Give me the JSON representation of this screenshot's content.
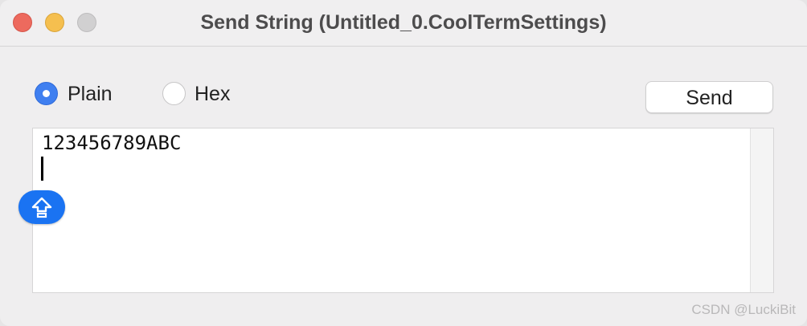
{
  "window": {
    "title": "Send String (Untitled_0.CoolTermSettings)"
  },
  "format": {
    "options": [
      {
        "label": "Plain",
        "selected": true
      },
      {
        "label": "Hex",
        "selected": false
      }
    ]
  },
  "actions": {
    "send_label": "Send"
  },
  "editor": {
    "text": "123456789ABC"
  },
  "indicators": {
    "caps_lock_icon": "caps-lock-icon"
  },
  "watermark": {
    "text": "CSDN @LuckiBit"
  },
  "colors": {
    "accent": "#3f7ff0",
    "caps_badge": "#1a73f2",
    "close": "#ed6a5e",
    "minimize": "#f5bf4f"
  }
}
